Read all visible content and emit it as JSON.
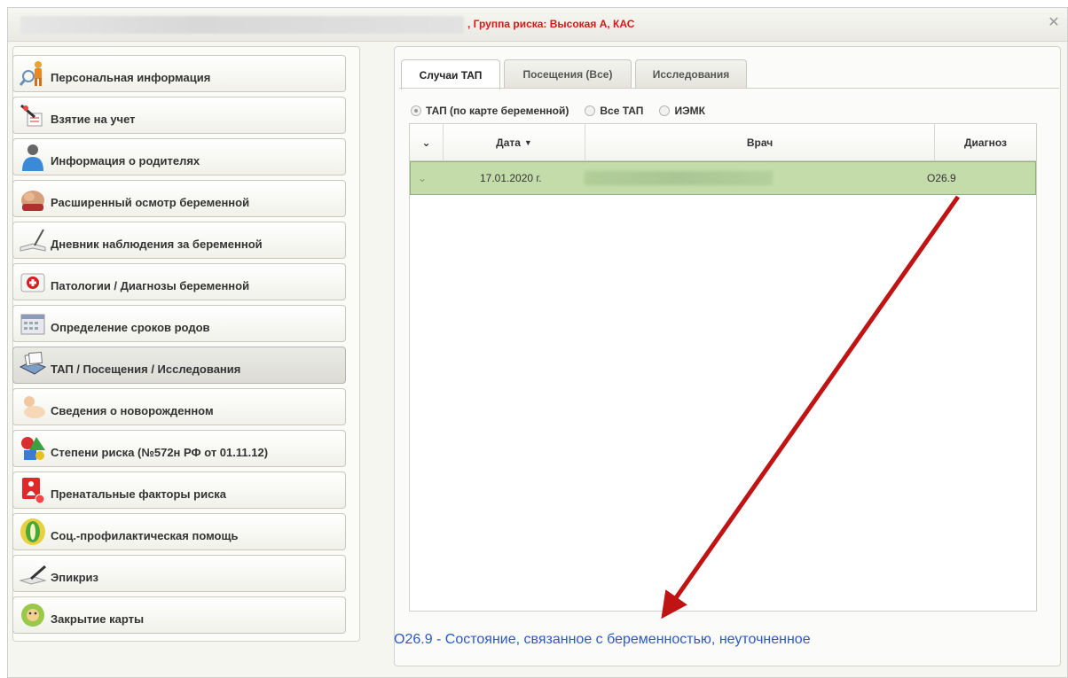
{
  "header": {
    "risk_text": ", Группа риска: Высокая А, КАС",
    "close_label": "✕"
  },
  "sidebar": {
    "items": [
      {
        "label": "Персональная информация",
        "icon": "person-magnifier-icon"
      },
      {
        "label": "Взятие на учет",
        "icon": "pen-document-icon"
      },
      {
        "label": "Информация о родителях",
        "icon": "parents-icon"
      },
      {
        "label": "Расширенный осмотр беременной",
        "icon": "pregnant-belly-icon"
      },
      {
        "label": "Дневник наблюдения за беременной",
        "icon": "notebook-pen-icon"
      },
      {
        "label": "Патологии / Диагнозы беременной",
        "icon": "medical-kit-icon"
      },
      {
        "label": "Определение сроков родов",
        "icon": "calendar-icon"
      },
      {
        "label": "ТАП / Посещения / Исследования",
        "icon": "card-file-icon",
        "active": true
      },
      {
        "label": "Сведения о новорожденном",
        "icon": "newborn-icon"
      },
      {
        "label": "Степени риска (№572н РФ от 01.11.12)",
        "icon": "risk-shapes-icon"
      },
      {
        "label": "Пренатальные факторы риска",
        "icon": "prenatal-risk-icon"
      },
      {
        "label": "Соц.-профилактическая помощь",
        "icon": "social-help-icon"
      },
      {
        "label": "Эпикриз",
        "icon": "epicrisis-pen-icon"
      },
      {
        "label": "Закрытие карты",
        "icon": "close-card-icon"
      }
    ]
  },
  "tabs": [
    {
      "label": "Случаи ТАП",
      "active": true
    },
    {
      "label": "Посещения (Все)",
      "active": false
    },
    {
      "label": "Исследования",
      "active": false
    }
  ],
  "filters": [
    {
      "label": "ТАП (по карте беременной)",
      "checked": true
    },
    {
      "label": "Все ТАП",
      "checked": false
    },
    {
      "label": "ИЭМК",
      "checked": false
    }
  ],
  "grid": {
    "columns": {
      "expand": "⌄",
      "date": "Дата",
      "doctor": "Врач",
      "diagnosis": "Диагноз"
    },
    "sort_indicator": "▼",
    "rows": [
      {
        "expand": "⌄",
        "date": "17.01.2020 г.",
        "diagnosis": "O26.9"
      }
    ]
  },
  "diagnosis_description": "O26.9 - Состояние, связанное с беременностью, неуточненное",
  "colors": {
    "risk_text": "#d81818",
    "selected_row": "#c3dcaa",
    "link_text": "#2a59c4",
    "arrow": "#c01414"
  }
}
